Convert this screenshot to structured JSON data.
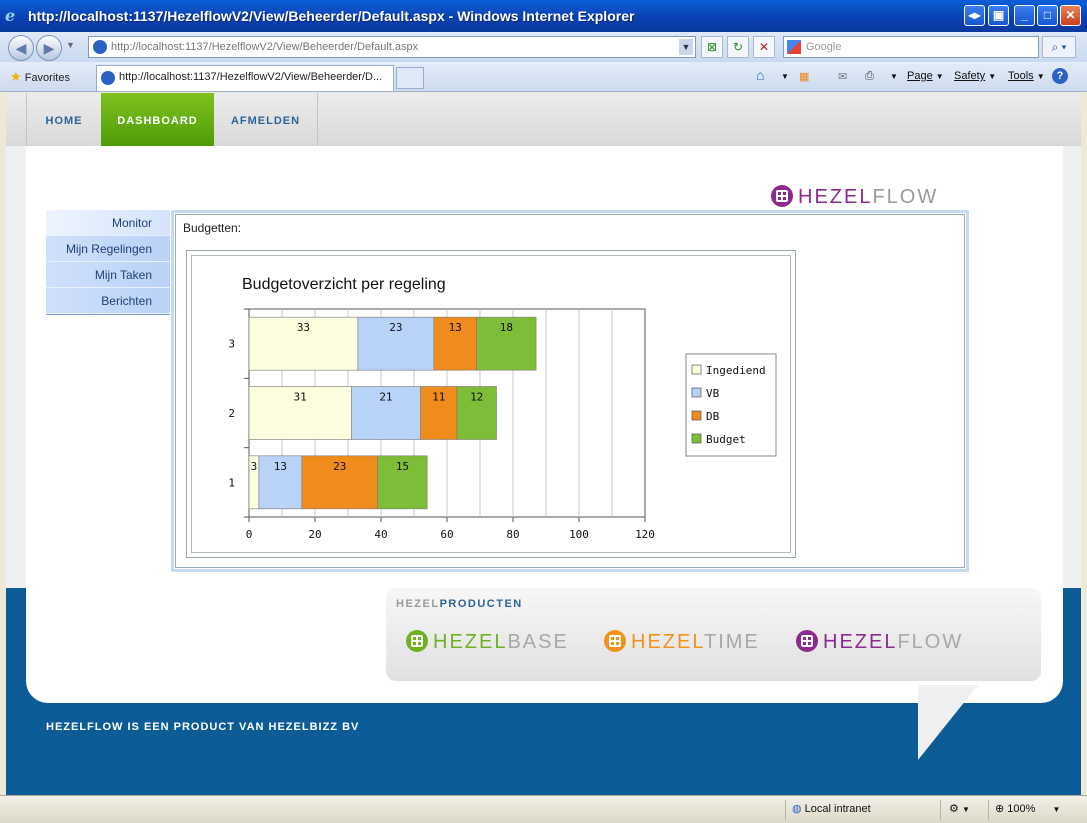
{
  "window": {
    "title": "http://localhost:1137/HezelflowV2/View/Beheerder/Default.aspx - Windows Internet Explorer",
    "controls": [
      "switch",
      "restore-flip",
      "minimize",
      "maximize",
      "close"
    ]
  },
  "browser": {
    "address": "http://localhost:1137/HezelflowV2/View/Beheerder/Default.aspx",
    "search_placeholder": "Google",
    "favorites_label": "Favorites",
    "tab_title": "http://localhost:1137/HezelflowV2/View/Beheerder/D...",
    "commands": {
      "page": "Page",
      "safety": "Safety",
      "tools": "Tools"
    }
  },
  "site": {
    "nav": [
      {
        "label": "HOME",
        "active": false
      },
      {
        "label": "DASHBOARD",
        "active": true
      },
      {
        "label": "AFMELDEN",
        "active": false
      }
    ],
    "logo": {
      "part1": "HEZEL",
      "part2": "FLOW",
      "color": "#8e2a8e"
    },
    "sidebar": [
      {
        "label": "Monitor",
        "active": true
      },
      {
        "label": "Mijn Regelingen",
        "active": false
      },
      {
        "label": "Mijn Taken",
        "active": false
      },
      {
        "label": "Berichten",
        "active": false
      }
    ],
    "section_label": "Budgetten:",
    "producten": {
      "header1": "HEZEL",
      "header2": "PRODUCTEN",
      "products": [
        {
          "part1": "HEZEL",
          "part2": "BASE",
          "color": "#6fb21f"
        },
        {
          "part1": "HEZEL",
          "part2": "TIME",
          "color": "#f39219"
        },
        {
          "part1": "HEZEL",
          "part2": "FLOW",
          "color": "#8e2a8e"
        }
      ]
    },
    "footer": "HEZELFLOW IS EEN PRODUCT VAN HEZELBIZZ BV"
  },
  "chart_data": {
    "type": "bar",
    "orientation": "horizontal",
    "stacked": true,
    "title": "Budgetoverzicht per regeling",
    "categories": [
      "1",
      "2",
      "3"
    ],
    "series": [
      {
        "name": "Ingediend",
        "values": [
          3,
          31,
          33
        ],
        "color": "#fdfde0"
      },
      {
        "name": "VB",
        "values": [
          13,
          21,
          23
        ],
        "color": "#b9d2f7"
      },
      {
        "name": "DB",
        "values": [
          23,
          11,
          13
        ],
        "color": "#f08c1c"
      },
      {
        "name": "Budget",
        "values": [
          15,
          12,
          18
        ],
        "color": "#7dbd38"
      }
    ],
    "xlim": [
      0,
      120
    ],
    "xticks": [
      "0",
      "20",
      "40",
      "60",
      "80",
      "100",
      "120"
    ],
    "grid": true,
    "legend": "right"
  },
  "statusbar": {
    "zone": "Local intranet",
    "zoom": "100%"
  }
}
